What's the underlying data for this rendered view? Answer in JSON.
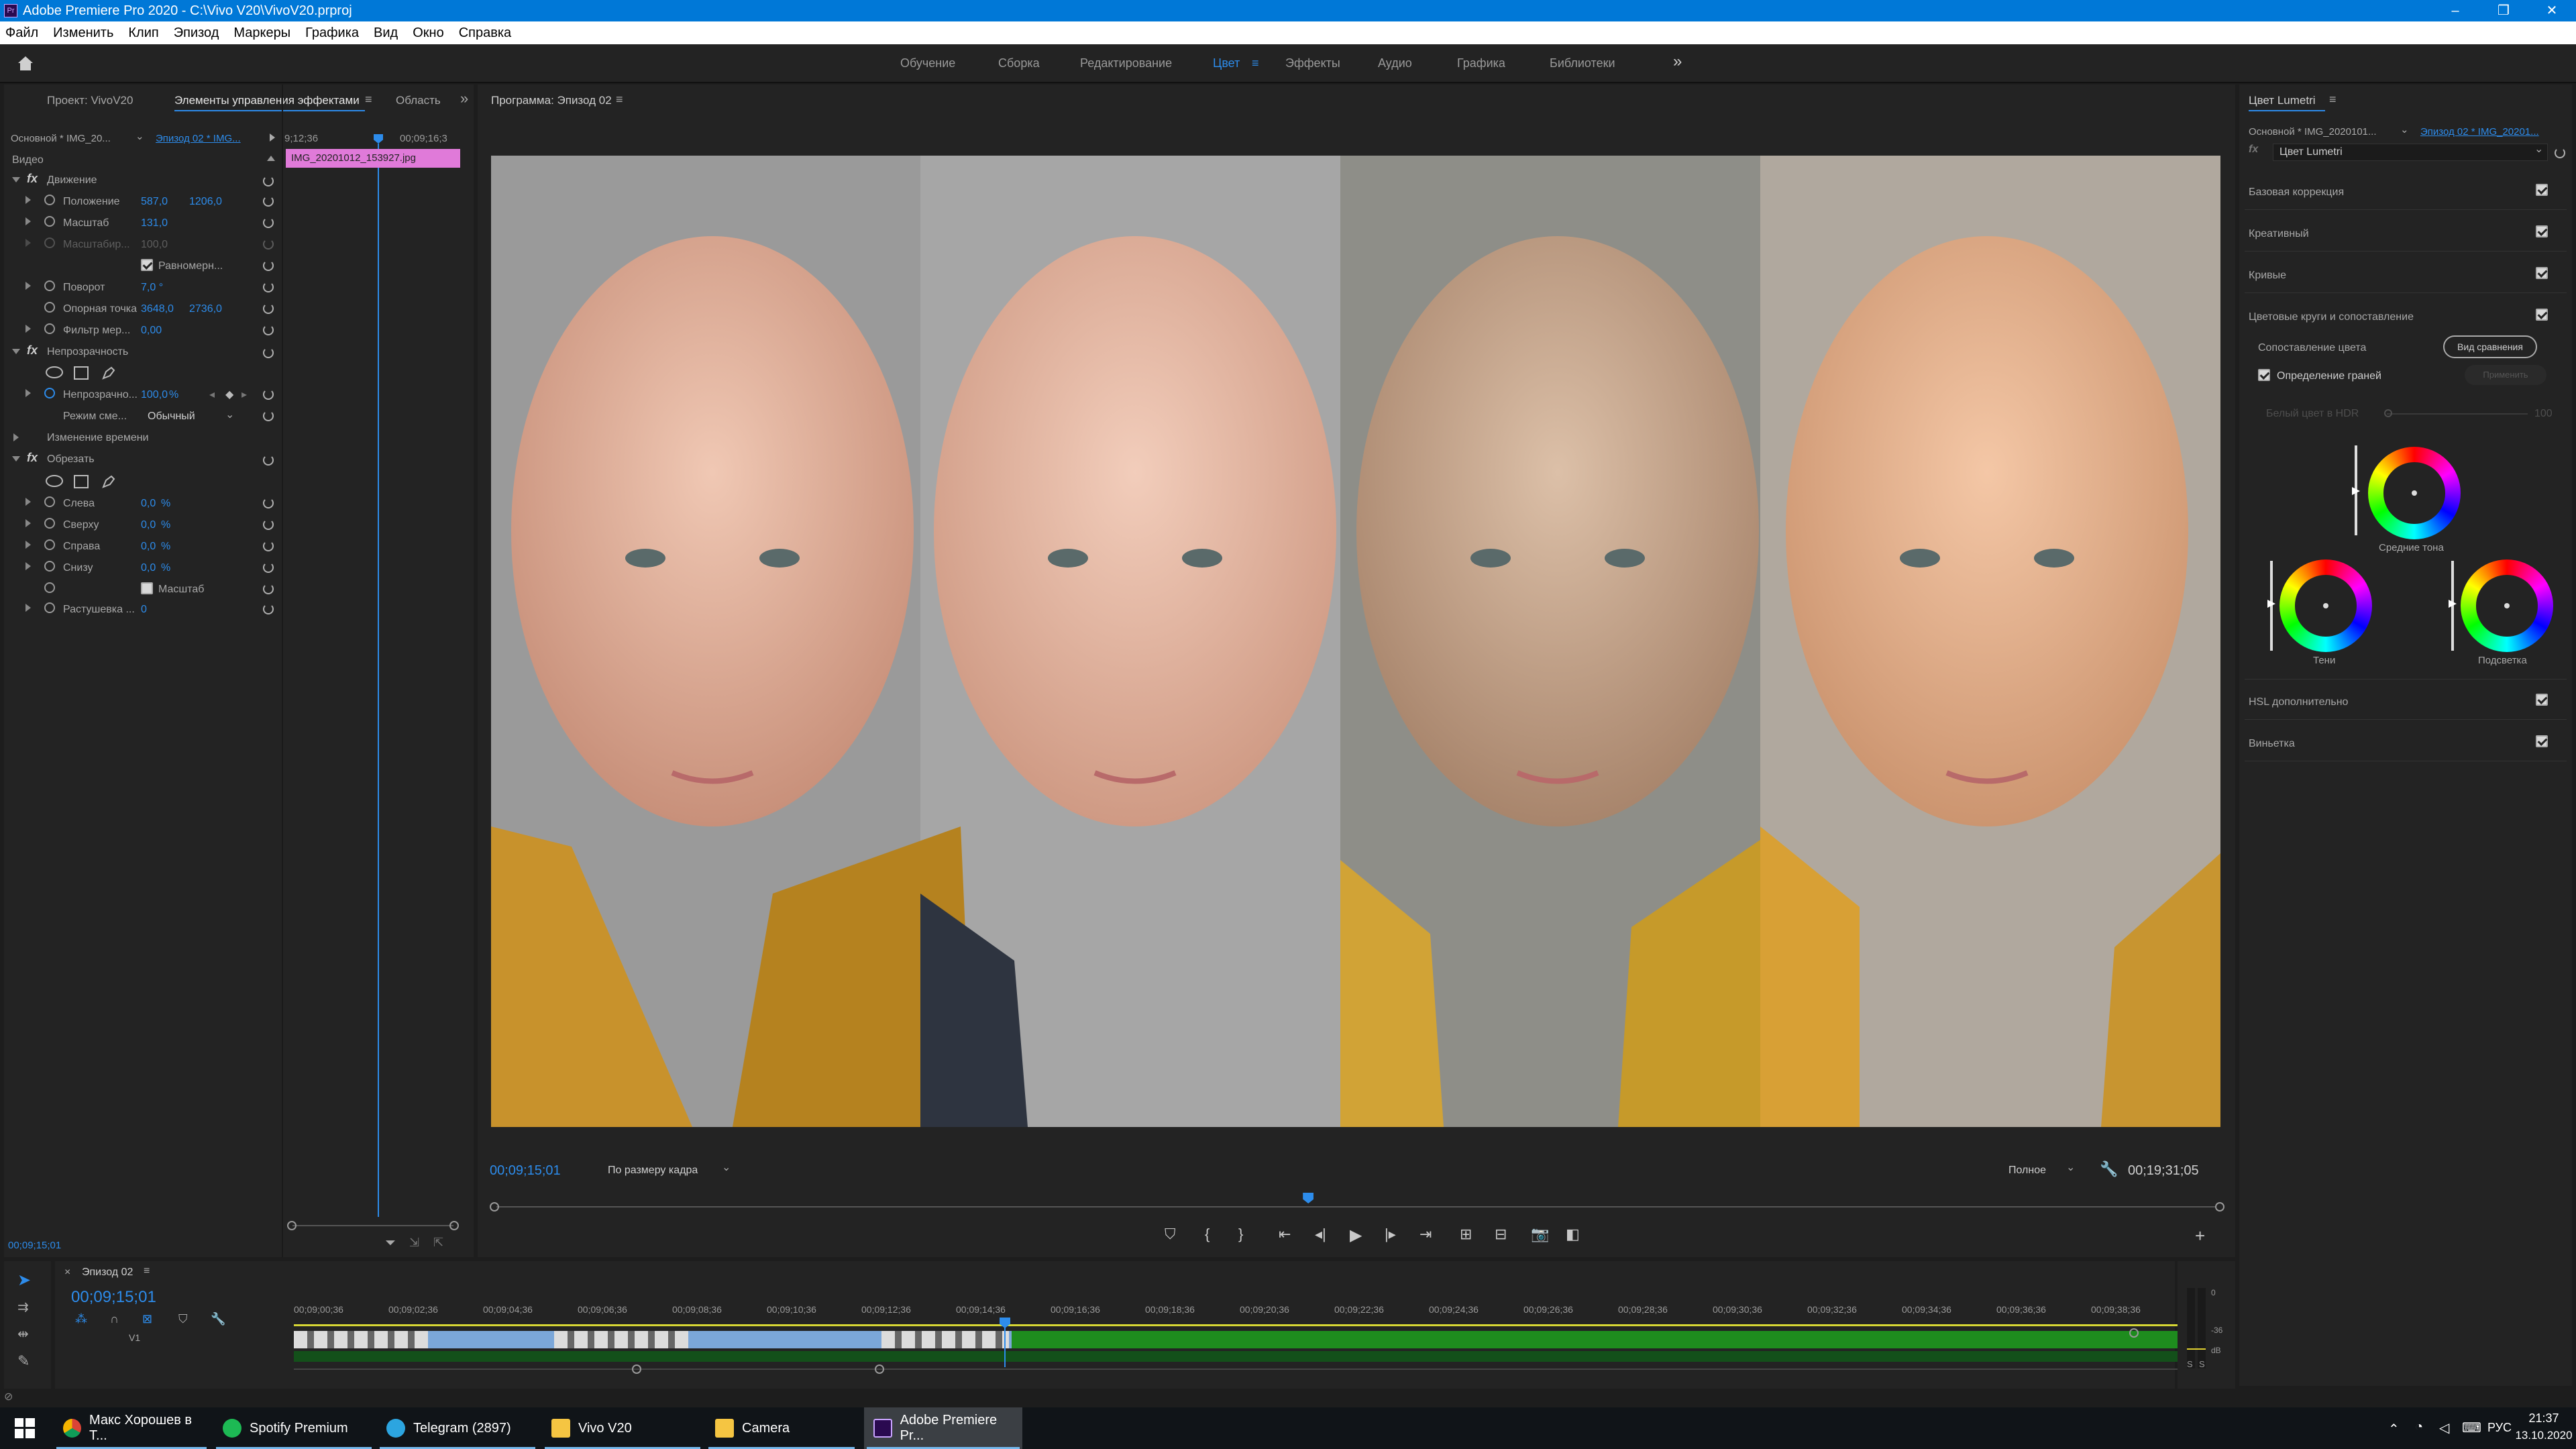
{
  "window": {
    "title": "Adobe Premiere Pro 2020 - C:\\Vivo V20\\VivoV20.prproj",
    "app_icon": "Pr"
  },
  "menu": [
    "Файл",
    "Изменить",
    "Клип",
    "Эпизод",
    "Маркеры",
    "Графика",
    "Вид",
    "Окно",
    "Справка"
  ],
  "workspaces": {
    "items": [
      "Обучение",
      "Сборка",
      "Редактирование",
      "Цвет",
      "Эффекты",
      "Аудио",
      "Графика",
      "Библиотеки"
    ],
    "active": "Цвет",
    "more": "»"
  },
  "left_panel": {
    "tabs": [
      "Проект: VivoV20",
      "Элементы управления эффектами",
      "Область"
    ],
    "master_clip": "Основной * IMG_20...",
    "sequence_clip": "Эпизод 02 * IMG...",
    "time_start": "9;12;36",
    "time_end": "00;09;16;3",
    "clip_name": "IMG_20201012_153927.jpg",
    "section_video": "Видео",
    "motion": {
      "title": "Движение",
      "position_label": "Положение",
      "position_x": "587,0",
      "position_y": "1206,0",
      "scale_label": "Масштаб",
      "scale_value": "131,0",
      "scale_width_label": "Масштабир...",
      "scale_width_value": "100,0",
      "uniform_label": "Равномерн...",
      "rotation_label": "Поворот",
      "rotation_value": "7,0 °",
      "anchor_label": "Опорная точка",
      "anchor_x": "3648,0",
      "anchor_y": "2736,0",
      "flicker_label": "Фильтр мер...",
      "flicker_value": "0,00"
    },
    "opacity": {
      "title": "Непрозрачность",
      "opacity_label": "Непрозрачно...",
      "opacity_value": "100,0",
      "opacity_unit": "%",
      "blend_label": "Режим сме...",
      "blend_value": "Обычный"
    },
    "time_remap": {
      "title": "Изменение времени"
    },
    "crop": {
      "title": "Обрезать",
      "left_label": "Слева",
      "left_value": "0,0",
      "left_unit": "%",
      "top_label": "Сверху",
      "top_value": "0,0",
      "top_unit": "%",
      "right_label": "Справа",
      "right_value": "0,0",
      "right_unit": "%",
      "bottom_label": "Снизу",
      "bottom_value": "0,0",
      "bottom_unit": "%",
      "zoom_label": "Масштаб",
      "feather_label": "Растушевка ...",
      "feather_value": "0"
    },
    "footer_time": "00;09;15;01"
  },
  "program": {
    "title": "Программа: Эпизод 02",
    "timecode": "00;09;15;01",
    "fit": "По размеру кадра",
    "quality": "Полное",
    "duration": "00;19;31;05",
    "playhead_fraction": 0.472
  },
  "lumetri": {
    "title": "Цвет Lumetri",
    "master_clip": "Основной * IMG_2020101...",
    "sequence_clip": "Эпизод 02 * IMG_20201...",
    "effect": "Цвет Lumetri",
    "sections": [
      "Базовая коррекция",
      "Креативный",
      "Кривые",
      "Цветовые круги и сопоставление"
    ],
    "color_match_label": "Сопоставление цвета",
    "compare_button": "Вид сравнения",
    "face_detect_label": "Определение граней",
    "apply_match": "Применить",
    "hdr_label": "Белый цвет в HDR",
    "hdr_value": "100",
    "wheels": {
      "midtones": "Средние тона",
      "shadows": "Тени",
      "highlights": "Подсветка"
    },
    "sections_bottom": [
      "HSL дополнительно",
      "Виньетка"
    ]
  },
  "timeline": {
    "title": "Эпизод 02",
    "timecode": "00;09;15;01",
    "track": "V1",
    "ruler": [
      "00;09;00;36",
      "00;09;02;36",
      "00;09;04;36",
      "00;09;06;36",
      "00;09;08;36",
      "00;09;10;36",
      "00;09;12;36",
      "00;09;14;36",
      "00;09;16;36",
      "00;09;18;36",
      "00;09;20;36",
      "00;09;22;36",
      "00;09;24;36",
      "00;09;26;36",
      "00;09;28;36",
      "00;09;30;36",
      "00;09;32;36",
      "00;09;34;36",
      "00;09;36;36",
      "00;09;38;36"
    ],
    "meter_labels": [
      "0",
      "-36",
      "dB"
    ],
    "meter_solo": [
      "S",
      "S"
    ]
  },
  "taskbar": {
    "items": [
      "Макс Хорошев в Т...",
      "Spotify Premium",
      "Telegram (2897)",
      "Vivo V20",
      "Camera",
      "Adobe Premiere Pr..."
    ],
    "active": "Adobe Premiere Pr...",
    "lang": "РУС",
    "time": "21:37",
    "date": "13.10.2020"
  },
  "colors": {
    "accent": "#2d8ceb",
    "clip_pink": "#e07ad9",
    "track_green": "#1e8c1e",
    "titlebar": "#0078d7"
  }
}
